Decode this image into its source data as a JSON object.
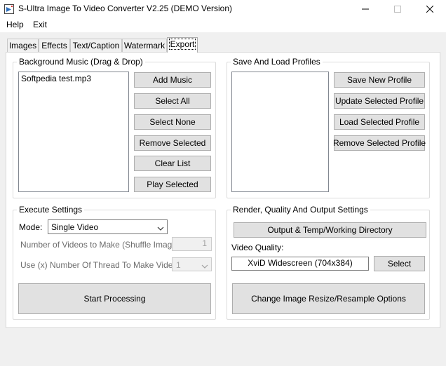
{
  "window": {
    "title": "S-Ultra Image To Video Converter V2.25 (DEMO Version)"
  },
  "menu": {
    "items": [
      "Help",
      "Exit"
    ]
  },
  "tabs": [
    {
      "label": "Images"
    },
    {
      "label": "Effects"
    },
    {
      "label": "Text/Caption"
    },
    {
      "label": "Watermark"
    },
    {
      "label": "Export",
      "active": true
    }
  ],
  "background_music": {
    "title": "Background Music (Drag & Drop)",
    "files": [
      "Softpedia test.mp3"
    ],
    "buttons": {
      "add": "Add Music",
      "select_all": "Select All",
      "select_none": "Select None",
      "remove_selected": "Remove Selected",
      "clear_list": "Clear List",
      "play_selected": "Play Selected"
    }
  },
  "profiles": {
    "title": "Save And Load Profiles",
    "buttons": {
      "save_new": "Save New Profile",
      "update_selected": "Update Selected Profile",
      "load_selected": "Load Selected Profile",
      "remove_selected": "Remove Selected Profile"
    }
  },
  "execute": {
    "title": "Execute Settings",
    "mode_label": "Mode:",
    "mode_value": "Single Video",
    "videos_label": "Number of Videos to Make (Shuffle Images):",
    "videos_value": "1",
    "threads_label": "Use (x) Number Of Thread To Make Video:",
    "threads_value": "1",
    "start_button": "Start Processing"
  },
  "render": {
    "title": "Render, Quality And Output Settings",
    "output_dir_button": "Output & Temp/Working Directory",
    "quality_label": "Video Quality:",
    "quality_value": "XviD Widescreen (704x384)",
    "select_button": "Select",
    "resize_button": "Change Image Resize/Resample Options"
  },
  "colors": {
    "window_bg": "#f0f0f0",
    "button_bg": "#e1e1e1",
    "button_border": "#adadad"
  }
}
